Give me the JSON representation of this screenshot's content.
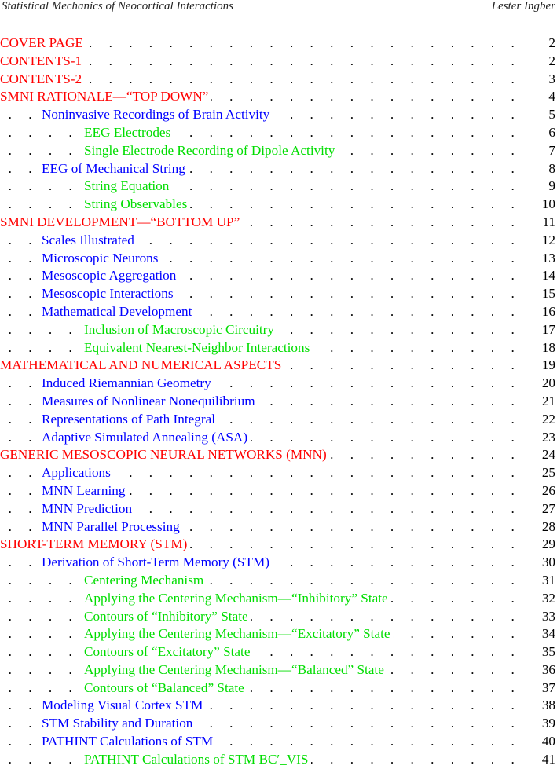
{
  "header": {
    "left": "Statistical Mechanics of Neocortical Interactions",
    "right": "Lester Ingber"
  },
  "toc": [
    {
      "level": 0,
      "title": "COVER PAGE",
      "page": "2"
    },
    {
      "level": 0,
      "title": "CONTENTS-1",
      "page": "2"
    },
    {
      "level": 0,
      "title": "CONTENTS-2",
      "page": "3"
    },
    {
      "level": 0,
      "title": "SMNI RATIONALE—“TOP DOWN”",
      "page": "4"
    },
    {
      "level": 1,
      "title": "Noninvasive Recordings of Brain Activity",
      "page": "5"
    },
    {
      "level": 2,
      "title": "EEG Electrodes",
      "page": "6"
    },
    {
      "level": 2,
      "title": "Single Electrode Recording of Dipole Activity",
      "page": "7"
    },
    {
      "level": 1,
      "title": "EEG of Mechanical String",
      "page": "8"
    },
    {
      "level": 2,
      "title": "String Equation",
      "page": "9"
    },
    {
      "level": 2,
      "title": "String Observables",
      "page": "10"
    },
    {
      "level": 0,
      "title": "SMNI DEVELOPMENT—“BOTTOM UP”",
      "page": "11"
    },
    {
      "level": 1,
      "title": "Scales Illustrated",
      "page": "12"
    },
    {
      "level": 1,
      "title": "Microscopic Neurons",
      "page": "13"
    },
    {
      "level": 1,
      "title": "Mesoscopic Aggregation",
      "page": "14"
    },
    {
      "level": 1,
      "title": "Mesoscopic Interactions",
      "page": "15"
    },
    {
      "level": 1,
      "title": "Mathematical Development",
      "page": "16"
    },
    {
      "level": 2,
      "title": "Inclusion of Macroscopic Circuitry",
      "page": "17"
    },
    {
      "level": 2,
      "title": "Equivalent Nearest-Neighbor Interactions",
      "page": "18"
    },
    {
      "level": 0,
      "title": "MATHEMATICAL AND NUMERICAL ASPECTS",
      "page": "19"
    },
    {
      "level": 1,
      "title": "Induced Riemannian Geometry",
      "page": "20"
    },
    {
      "level": 1,
      "title": "Measures of Nonlinear Nonequilibrium",
      "page": "21"
    },
    {
      "level": 1,
      "title": "Representations of Path Integral",
      "page": "22"
    },
    {
      "level": 1,
      "title": "Adaptive Simulated Annealing (ASA)",
      "page": "23"
    },
    {
      "level": 0,
      "title": "GENERIC MESOSCOPIC NEURAL NETWORKS (MNN)",
      "page": "24"
    },
    {
      "level": 1,
      "title": "Applications",
      "page": "25"
    },
    {
      "level": 1,
      "title": "MNN Learning",
      "page": "26"
    },
    {
      "level": 1,
      "title": "MNN Prediction",
      "page": "27"
    },
    {
      "level": 1,
      "title": "MNN Parallel Processing",
      "page": "28"
    },
    {
      "level": 0,
      "title": "SHORT-TERM MEMORY (STM)",
      "page": "29"
    },
    {
      "level": 1,
      "title": "Derivation of Short-Term Memory (STM)",
      "page": "30"
    },
    {
      "level": 2,
      "title": "Centering Mechanism",
      "page": "31"
    },
    {
      "level": 2,
      "title": "Applying the Centering Mechanism—“Inhibitory” State",
      "page": "32"
    },
    {
      "level": 2,
      "title": "Contours of “Inhibitory” State",
      "page": "33"
    },
    {
      "level": 2,
      "title": "Applying the Centering Mechanism—“Excitatory” State",
      "page": "34"
    },
    {
      "level": 2,
      "title": "Contours of “Excitatory” State",
      "page": "35"
    },
    {
      "level": 2,
      "title": "Applying the Centering Mechanism—“Balanced” State",
      "page": "36"
    },
    {
      "level": 2,
      "title": "Contours of “Balanced” State",
      "page": "37"
    },
    {
      "level": 1,
      "title": "Modeling Visual Cortex STM",
      "page": "38"
    },
    {
      "level": 1,
      "title": "STM Stability and Duration",
      "page": "39"
    },
    {
      "level": 1,
      "title": "PATHINT Calculations of STM",
      "page": "40"
    },
    {
      "level": 2,
      "title": "PATHINT Calculations of STM BC′_VIS",
      "page": "41"
    }
  ],
  "colors": {
    "level0": "#ff0000",
    "level1": "#0000ff",
    "level2": "#00dd00"
  }
}
